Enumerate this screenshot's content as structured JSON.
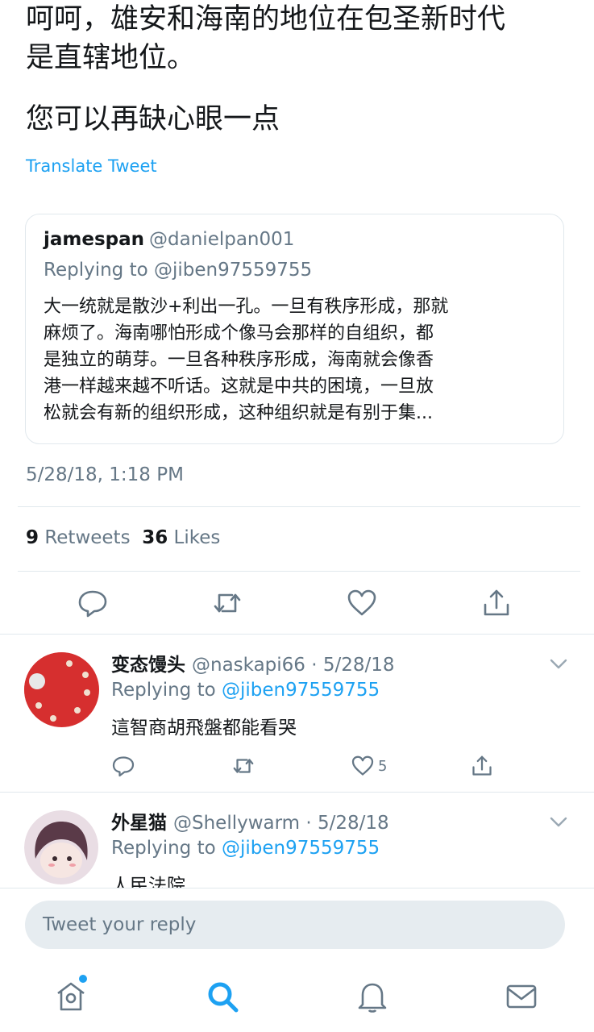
{
  "tweet": {
    "text_line1": "呵呵，雄安和海南的地位在包圣新时代",
    "text_line2": "是直辖地位。",
    "text_line3": "您可以再缺心眼一点",
    "translate_label": "Translate Tweet",
    "timestamp": "5/28/18, 1:18 PM",
    "retweets_count": "9",
    "retweets_label": "Retweets",
    "likes_count": "36",
    "likes_label": "Likes"
  },
  "quote": {
    "name": "jamespan",
    "handle": "@danielpan001",
    "replying_to": "Replying to @jiben97559755",
    "body_lines": [
      "大一统就是散沙+利出一孔。一旦有秩序形成，那就",
      "麻烦了。海南哪怕形成个像马会那样的自组织，都",
      "是独立的萌芽。一旦各种秩序形成，海南就会像香",
      "港一样越来越不听话。这就是中共的困境，一旦放",
      "松就会有新的组织形成，这种组织就是有别于集..."
    ]
  },
  "replies": [
    {
      "name": "变态馒头",
      "handle_date": "@naskapi66 · 5/28/18",
      "replying_prefix": "Replying to ",
      "replying_handle": "@jiben97559755",
      "text": "這智商胡飛盤都能看哭",
      "like_count": "5"
    },
    {
      "name": "外星猫",
      "handle_date": "@Shellywarm · 5/28/18",
      "replying_prefix": "Replying to ",
      "replying_handle": "@jiben97559755",
      "text": "人民法院"
    }
  ],
  "compose": {
    "placeholder": "Tweet your reply"
  },
  "icons": {
    "reply": "reply-icon",
    "retweet": "retweet-icon",
    "like": "heart-icon",
    "share": "share-icon",
    "chevron": "chevron-down-icon",
    "home": "home-icon",
    "search": "search-icon",
    "notifications": "bell-icon",
    "messages": "mail-icon"
  },
  "colors": {
    "accent": "#1da1f2",
    "secondary": "#657786",
    "text": "#14171a",
    "divider": "#e1e8ed"
  }
}
